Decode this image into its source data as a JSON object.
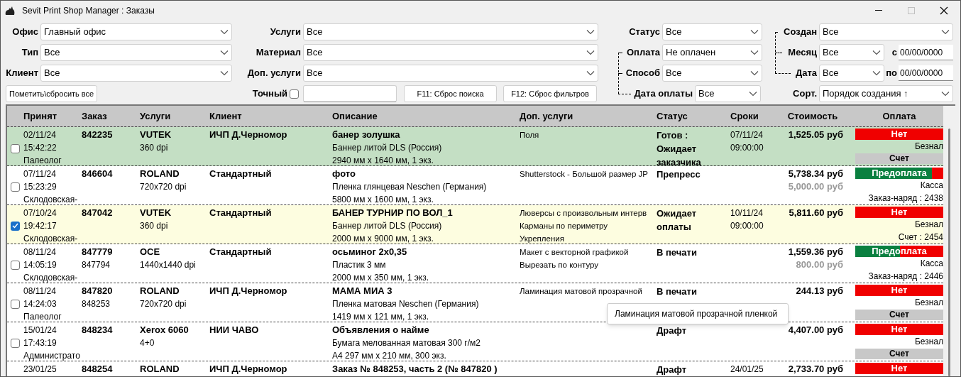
{
  "window": {
    "title": "Sevit Print Shop Manager : Заказы",
    "maximize_enabled": false
  },
  "filters": {
    "left": [
      {
        "label": "Офис",
        "value": "Главный офис"
      },
      {
        "label": "Тип",
        "value": "Все"
      },
      {
        "label": "Клиент",
        "value": "Все"
      }
    ],
    "mark_all_button": "Пометить\\сбросить все",
    "middle": [
      {
        "label": "Услуги",
        "value": "Все"
      },
      {
        "label": "Материал",
        "value": "Все"
      },
      {
        "label": "Доп. услуги",
        "value": "Все"
      }
    ],
    "exact": {
      "label": "Точный",
      "checked": false
    },
    "reset_search": "F11: Сброс поиска",
    "reset_filters": "F12: Сброс фильтров",
    "status": {
      "label": "Статус",
      "value": "Все"
    },
    "payment": [
      {
        "label": "Оплата",
        "value": "Не оплачен"
      },
      {
        "label": "Способ",
        "value": "Все"
      },
      {
        "label": "Дата оплаты",
        "value": "Все"
      }
    ],
    "created": {
      "label": "Создан",
      "value": "Все"
    },
    "month": {
      "label": "Месяц",
      "value": "Все",
      "range_label": "с",
      "range_value": "00/00/0000"
    },
    "date": {
      "label": "Дата",
      "value": "Все",
      "range_label": "по",
      "range_value": "00/00/0000"
    },
    "sort": {
      "label": "Сорт.",
      "value": "Порядок создания ↑"
    }
  },
  "table": {
    "columns": [
      "Принят",
      "Заказ",
      "Услуги",
      "Клиент",
      "Описание",
      "Доп. услуги",
      "Статус",
      "Сроки",
      "Стоимость",
      "Оплата"
    ],
    "rows": [
      {
        "color": "#c4dfc4",
        "checked": false,
        "accepted": [
          "02/11/24",
          "15:42:22",
          "Палеолог"
        ],
        "order": [
          "842235"
        ],
        "service": [
          "VUTEK",
          "360 dpi"
        ],
        "client": "ИЧП Д.Черномор",
        "description": [
          "банер золушка",
          "Баннер литой DLS (Россия)",
          "2940 мм x 1640 мм, 1 экз."
        ],
        "extras": [
          "Поля"
        ],
        "status": "Готов : Ожидает заказчика",
        "deadline": [
          "07/11/24",
          "09:00:00"
        ],
        "cost": [
          "1,525.05 руб"
        ],
        "payment": {
          "label": "Нет",
          "level": 0,
          "method": "Безнал",
          "document": {
            "kind": "button",
            "text": "Счет"
          }
        }
      },
      {
        "color": "#ffffff",
        "checked": false,
        "accepted": [
          "07/11/24",
          "15:23:29",
          "Склодовская-"
        ],
        "order": [
          "846604"
        ],
        "service": [
          "ROLAND",
          "720x720 dpi"
        ],
        "client": "Стандартный",
        "description": [
          "фото",
          "Пленка глянцевая Neschen (Германия)",
          "5800 мм x 1600 мм, 1 экз."
        ],
        "extras": [
          "Shutterstock - Большой размер JP"
        ],
        "status": "Препресс",
        "deadline": [],
        "cost": [
          "5,738.34 руб",
          "5,000.00 руб"
        ],
        "payment": {
          "label": "Предоплата",
          "level": 0.87,
          "method": "Касса",
          "document": {
            "kind": "text",
            "text": "Заказ-наряд : 2438"
          }
        }
      },
      {
        "color": "#fdfde0",
        "checked": true,
        "accepted": [
          "07/10/24",
          "19:42:17",
          "Склодовская-"
        ],
        "order": [
          "847042"
        ],
        "service": [
          "VUTEK",
          "360 dpi"
        ],
        "client": "Стандартный",
        "description": [
          "БАНЕР ТУРНИР ПО ВОЛ_1",
          "Баннер литой DLS (Россия)",
          "2000 мм x 9000 мм, 1 экз."
        ],
        "extras": [
          "Люверсы с произвольным интерв",
          "Карманы по периметру",
          "Укрепления"
        ],
        "status": "Ожидает оплаты",
        "deadline": [
          "10/11/24",
          "09:00:00"
        ],
        "cost": [
          "5,811.60 руб"
        ],
        "payment": {
          "label": "Нет",
          "level": 0,
          "method": "Безнал",
          "document": {
            "kind": "text",
            "text": "Счет : 2454"
          }
        }
      },
      {
        "color": "#ffffff",
        "checked": false,
        "accepted": [
          "08/11/24",
          "14:05:19",
          "Склодовская-"
        ],
        "order": [
          "847779",
          "847794"
        ],
        "service": [
          "OCE",
          "1440x1440 dpi"
        ],
        "client": "Стандартный",
        "description": [
          "осьминог 2x0,35",
          "Пластик 3 мм",
          "2000 мм x 350 мм, 1 экз."
        ],
        "extras": [
          "Макет с векторной графикой",
          "Вырезать по контуру"
        ],
        "status": "В печати",
        "deadline": [],
        "cost": [
          "1,559.36 руб",
          "800.00 руб"
        ],
        "payment": {
          "label": "Предоплата",
          "level": 0.51,
          "method": "Касса",
          "document": {
            "kind": "text",
            "text": "Заказ-наряд : 2446"
          }
        }
      },
      {
        "color": "#ffffff",
        "checked": false,
        "accepted": [
          "08/11/24",
          "14:24:03",
          "Палеолог"
        ],
        "order": [
          "847820",
          "848253"
        ],
        "service": [
          "ROLAND",
          "720x720 dpi"
        ],
        "client": "ИЧП Д.Черномор",
        "description": [
          "МАМА МИА 3",
          "Пленка матовая Neschen (Германия)",
          "1419 мм x 121 мм, 1 экз."
        ],
        "extras": [
          "Ламинация матовой прозрачной"
        ],
        "status": "В печати",
        "deadline": [],
        "cost": [
          "244.13 руб"
        ],
        "payment": {
          "label": "Нет",
          "level": 0,
          "method": "Безнал",
          "document": {
            "kind": "button",
            "text": "Счет"
          }
        }
      },
      {
        "color": "#ffffff",
        "checked": false,
        "accepted": [
          "15/01/24",
          "17:43:19",
          "Администрато"
        ],
        "order": [
          "848234"
        ],
        "service": [
          "Xerox 6060",
          "4+0"
        ],
        "client": "НИИ ЧАВО",
        "description": [
          "Объявления о найме",
          "Бумага мелованная матовая 300 г/м2",
          "А4 297 мм x 210 мм, 300 экз."
        ],
        "extras": [],
        "status": "Драфт",
        "deadline": [],
        "cost": [
          "4,407.00 руб"
        ],
        "payment": {
          "label": "Нет",
          "level": 0,
          "method": "Безнал",
          "document": {
            "kind": "button",
            "text": "Счет"
          }
        }
      },
      {
        "color": "#ffffff",
        "accepted": [
          "23/01/25"
        ],
        "order": [
          "848254"
        ],
        "service": [
          "ROLAND"
        ],
        "client": "ИЧП Д.Черномор",
        "description": [
          "Заказ № 848253, часть 2 (№ 847820 )"
        ],
        "extras": [],
        "status": "Драфт",
        "deadline": [
          "24/01/25"
        ],
        "cost": [
          "2,733.70 руб"
        ],
        "payment": {
          "label": "Нет"
        }
      }
    ]
  },
  "tooltip": "Ламинация матовой прозрачной пленкой"
}
